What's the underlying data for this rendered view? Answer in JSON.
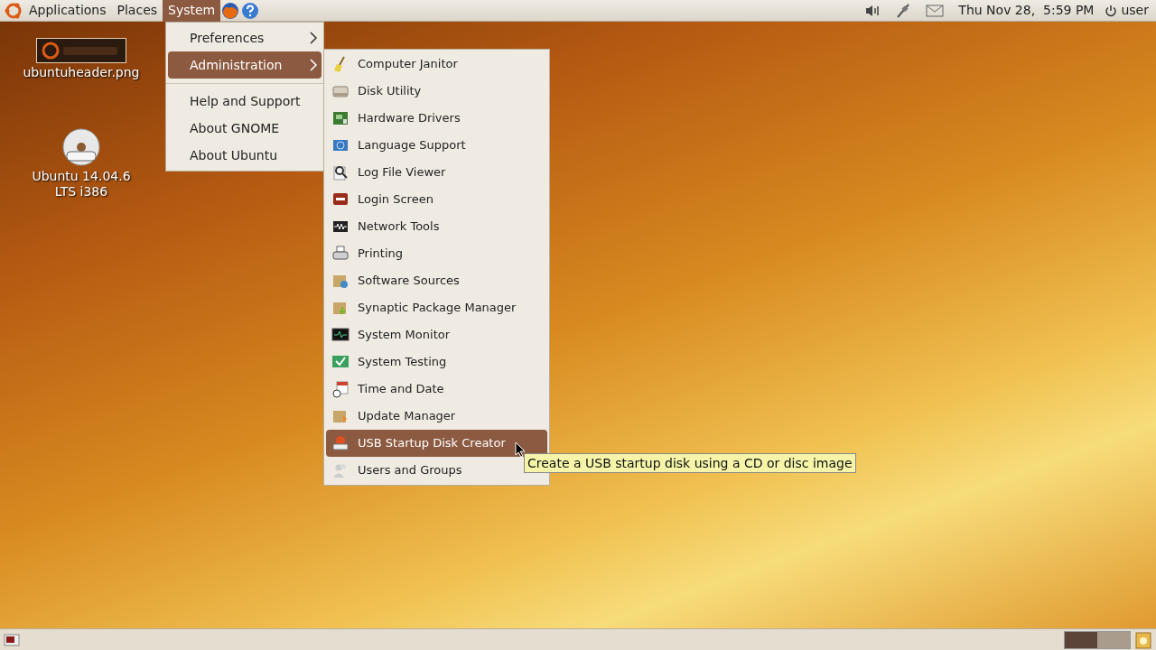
{
  "top_panel": {
    "menus": [
      {
        "label": "Applications",
        "selected": false
      },
      {
        "label": "Places",
        "selected": false
      },
      {
        "label": "System",
        "selected": true
      }
    ],
    "clock": "Thu Nov 28,  5:59 PM",
    "user": "user"
  },
  "desktop_icons": [
    {
      "label": "ubuntuheader.png",
      "kind": "picture"
    },
    {
      "label": "Ubuntu 14.04.6 LTS i386",
      "kind": "dvd"
    }
  ],
  "system_menu": [
    {
      "label": "Preferences",
      "kind": "submenu",
      "selected": false
    },
    {
      "label": "Administration",
      "kind": "submenu",
      "selected": true
    },
    {
      "kind": "separator"
    },
    {
      "label": "Help and Support",
      "kind": "item",
      "selected": false
    },
    {
      "label": "About GNOME",
      "kind": "item",
      "selected": false
    },
    {
      "label": "About Ubuntu",
      "kind": "item",
      "selected": false
    }
  ],
  "administration_menu": [
    {
      "label": "Computer Janitor",
      "selected": false
    },
    {
      "label": "Disk Utility",
      "selected": false
    },
    {
      "label": "Hardware Drivers",
      "selected": false
    },
    {
      "label": "Language Support",
      "selected": false
    },
    {
      "label": "Log File Viewer",
      "selected": false
    },
    {
      "label": "Login Screen",
      "selected": false
    },
    {
      "label": "Network Tools",
      "selected": false
    },
    {
      "label": "Printing",
      "selected": false
    },
    {
      "label": "Software Sources",
      "selected": false
    },
    {
      "label": "Synaptic Package Manager",
      "selected": false
    },
    {
      "label": "System Monitor",
      "selected": false
    },
    {
      "label": "System Testing",
      "selected": false
    },
    {
      "label": "Time and Date",
      "selected": false
    },
    {
      "label": "Update Manager",
      "selected": false
    },
    {
      "label": "USB Startup Disk Creator",
      "selected": true
    },
    {
      "label": "Users and Groups",
      "selected": false
    }
  ],
  "tooltip": "Create a USB startup disk using a CD or disc image",
  "bottom_panel": {
    "workspaces": [
      {
        "selected": true
      },
      {
        "selected": false
      }
    ]
  }
}
